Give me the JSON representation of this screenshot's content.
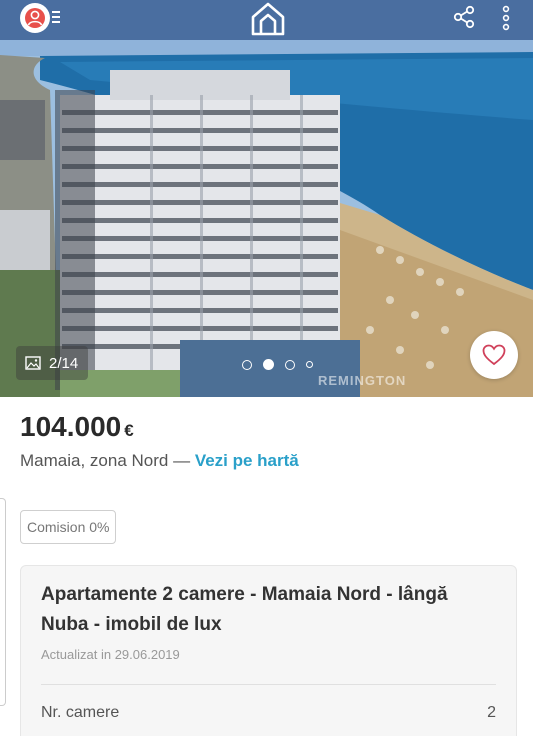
{
  "topbar": {
    "avatar_icon": "user-icon",
    "menu_icon": "menu-icon",
    "logo_icon": "home-logo-icon",
    "share_icon": "share-icon",
    "more_icon": "more-vertical-icon"
  },
  "gallery": {
    "counter": "2/14",
    "counter_icon": "image-icon",
    "current_index": 2,
    "dots_count": 4,
    "favorite_icon": "heart-icon",
    "watermark": "REMINGTON"
  },
  "listing": {
    "price": "104.000",
    "currency": "€",
    "location": "Mamaia, zona Nord —",
    "map_link": "Vezi pe hartă",
    "commission": "Comision 0%",
    "title": "Apartamente 2 camere - Mamaia Nord - lângă Nuba - imobil de lux",
    "updated": "Actualizat in 29.06.2019",
    "specs": [
      {
        "label": "Nr. camere",
        "value": "2"
      }
    ]
  },
  "colors": {
    "link": "#2aa0c9",
    "price": "#2a2a2a",
    "heart": "#d0405a"
  }
}
